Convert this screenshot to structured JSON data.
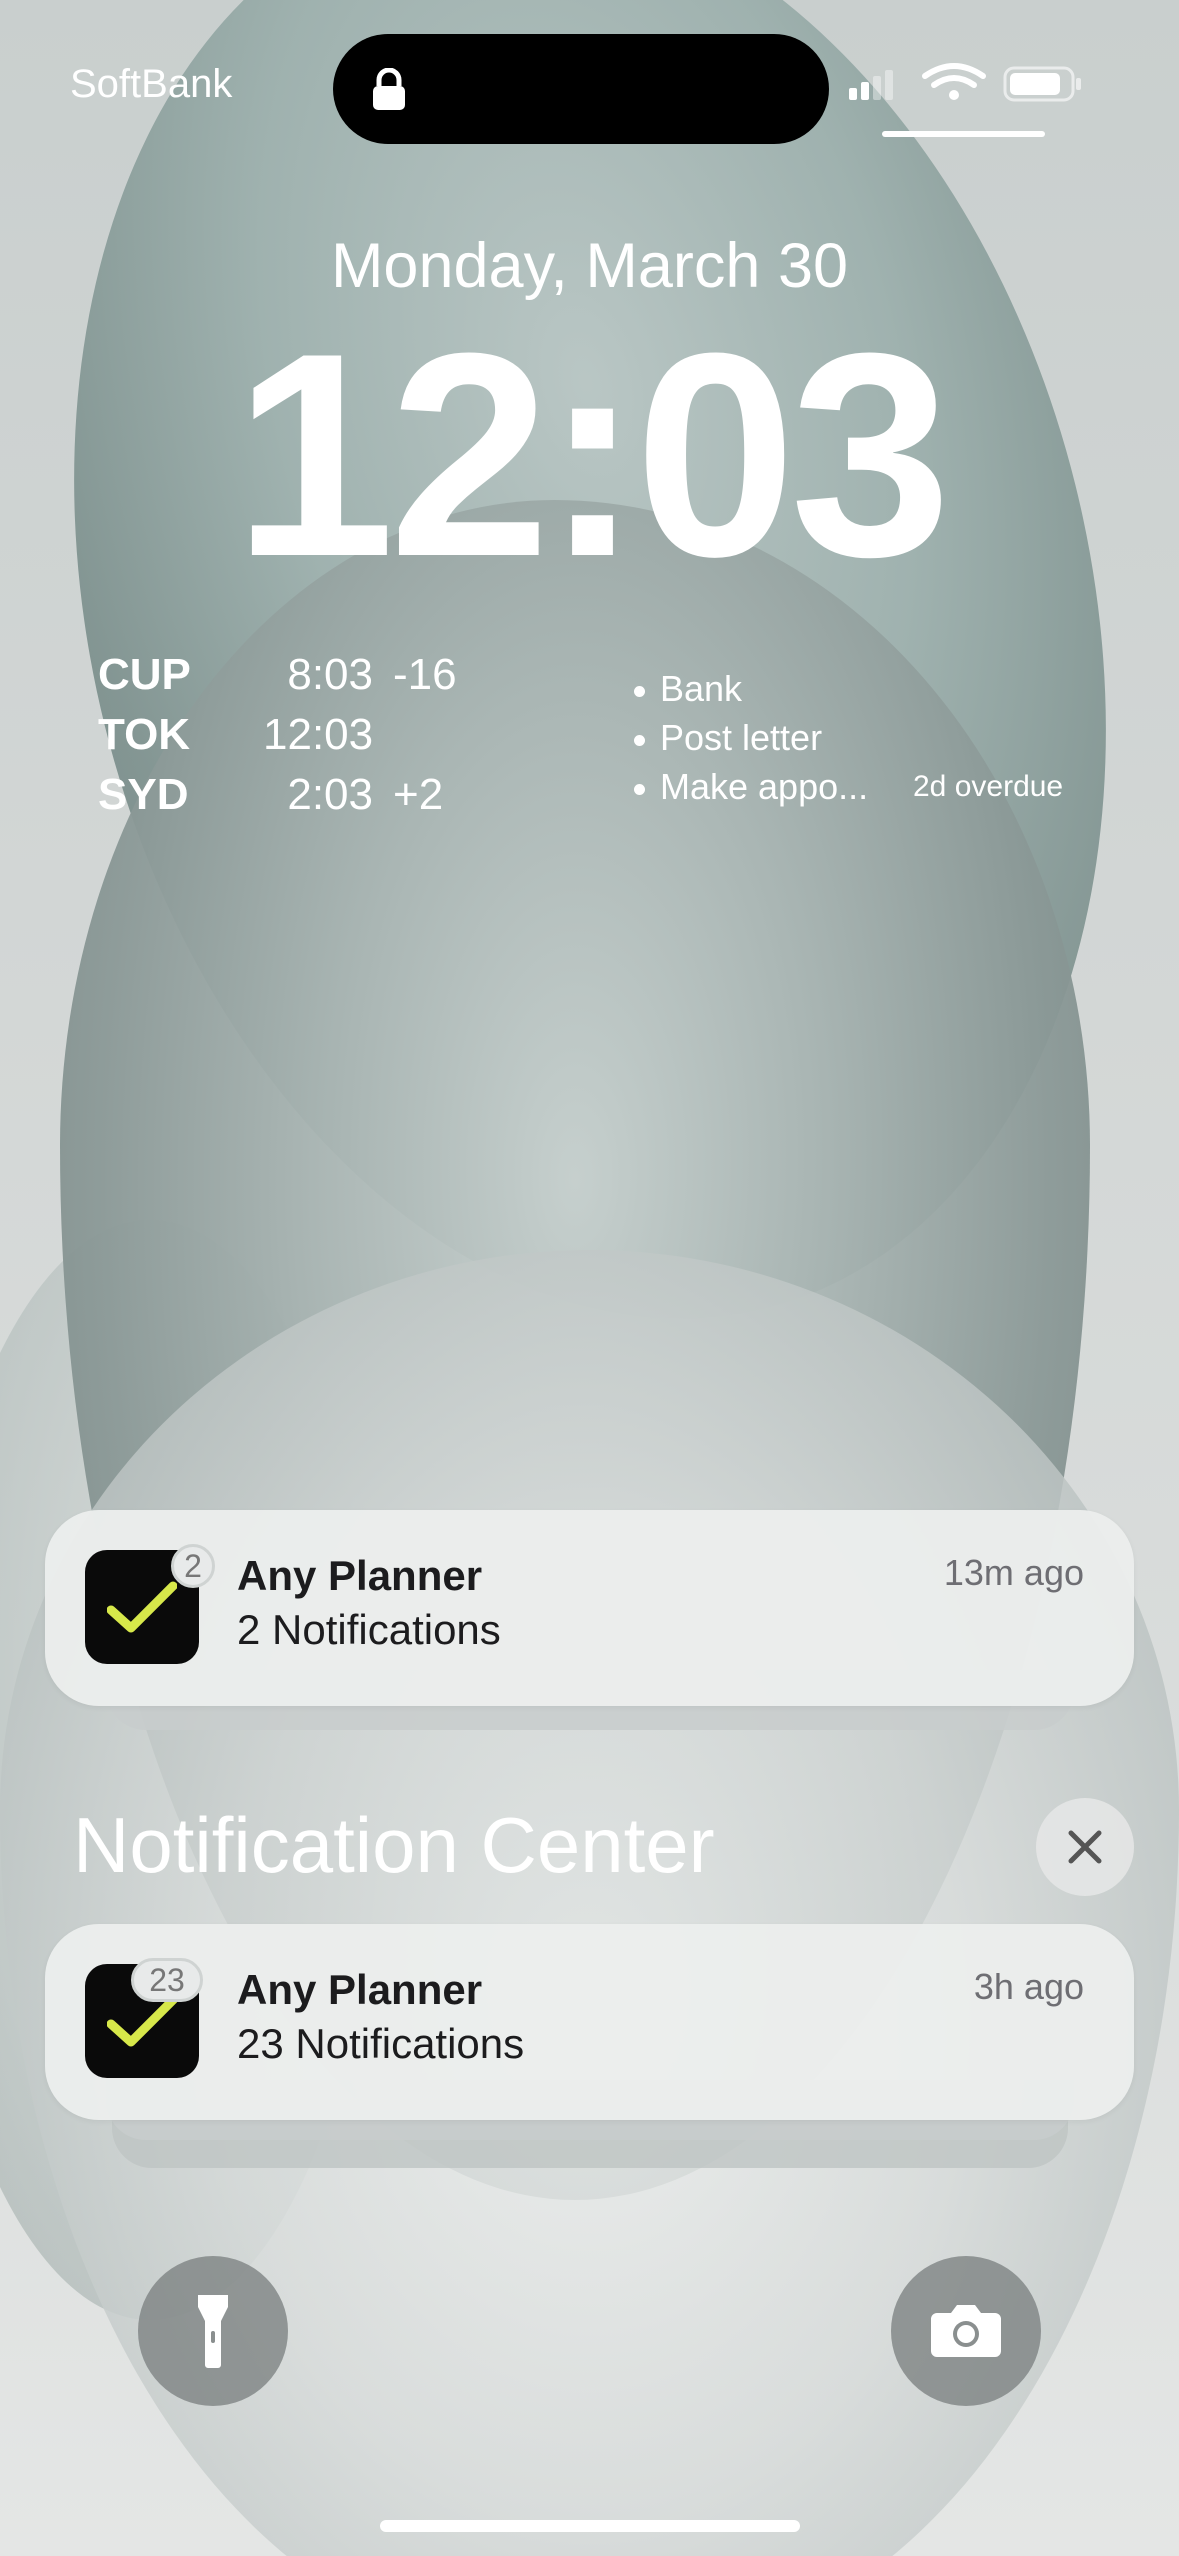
{
  "status_bar": {
    "carrier": "SoftBank",
    "icons": [
      "lock-icon",
      "cellular-signal-icon",
      "wifi-icon",
      "battery-icon"
    ]
  },
  "lock_screen": {
    "date": "Monday, March 30",
    "time": "12:03"
  },
  "world_clock": [
    {
      "city": "CUP",
      "time": "8:03",
      "offset": "-16"
    },
    {
      "city": "TOK",
      "time": "12:03",
      "offset": ""
    },
    {
      "city": "SYD",
      "time": "2:03",
      "offset": "+2"
    }
  ],
  "reminders": {
    "items": [
      "Bank",
      "Post letter",
      "Make appo..."
    ],
    "due_label": "2d overdue"
  },
  "notifications": [
    {
      "app": "Any Planner",
      "summary": "2 Notifications",
      "time_ago": "13m ago",
      "badge": "2"
    },
    {
      "app": "Any Planner",
      "summary": "23 Notifications",
      "time_ago": "3h ago",
      "badge": "23"
    }
  ],
  "notification_center": {
    "title": "Notification Center"
  },
  "quick_actions": [
    "flashlight-icon",
    "camera-icon"
  ],
  "colors": {
    "checkmark": "#d7e84a",
    "app_icon_bg": "#0a0a0a"
  }
}
